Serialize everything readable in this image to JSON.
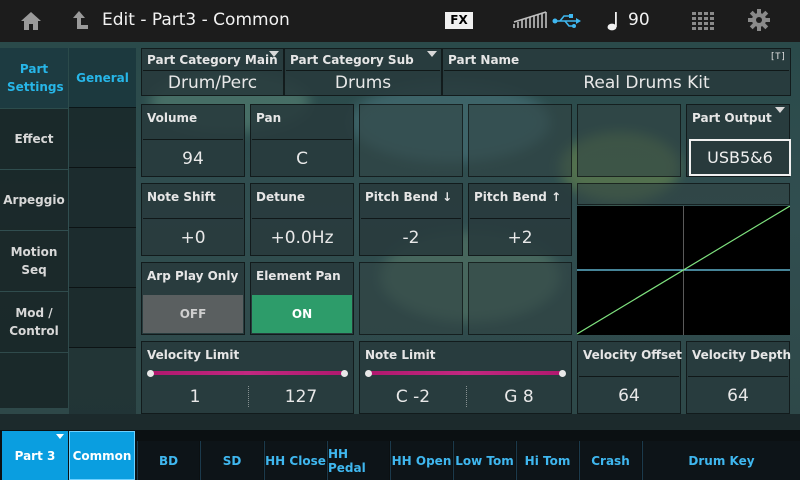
{
  "header": {
    "title": "Edit - Part3 - Common",
    "fx_label": "FX",
    "tempo": "90",
    "icons": [
      "home-icon",
      "up-arrow-icon",
      "meter-icon",
      "usb-icon",
      "quarter-note-icon",
      "keypad-grid-icon",
      "gear-icon"
    ]
  },
  "nav_primary": [
    {
      "label": "Part Settings",
      "active": true
    },
    {
      "label": "Effect",
      "active": false
    },
    {
      "label": "Arpeggio",
      "active": false
    },
    {
      "label": "Motion Seq",
      "active": false
    },
    {
      "label": "Mod / Control",
      "active": false
    }
  ],
  "nav_secondary": [
    {
      "label": "General",
      "active": true
    }
  ],
  "params": {
    "category_main": {
      "label": "Part Category Main",
      "value": "Drum/Perc"
    },
    "category_sub": {
      "label": "Part Category Sub",
      "value": "Drums"
    },
    "part_name": {
      "label": "Part Name",
      "value": "Real Drums Kit",
      "badge": "[T]"
    },
    "volume": {
      "label": "Volume",
      "value": "94"
    },
    "pan": {
      "label": "Pan",
      "value": "C"
    },
    "part_output": {
      "label": "Part Output",
      "value": "USB5&6"
    },
    "note_shift": {
      "label": "Note Shift",
      "value": "+0"
    },
    "detune": {
      "label": "Detune",
      "value": "+0.0Hz"
    },
    "pitch_bend_down": {
      "label": "Pitch Bend ↓",
      "value": "-2"
    },
    "pitch_bend_up": {
      "label": "Pitch Bend ↑",
      "value": "+2"
    },
    "arp_play_only": {
      "label": "Arp Play Only",
      "value": "OFF"
    },
    "element_pan": {
      "label": "Element Pan",
      "value": "ON"
    },
    "velocity_limit": {
      "label": "Velocity Limit",
      "low": "1",
      "high": "127"
    },
    "note_limit": {
      "label": "Note Limit",
      "low": "C -2",
      "high": "G 8"
    },
    "velocity_offset": {
      "label": "Velocity Offset",
      "value": "64"
    },
    "velocity_depth": {
      "label": "Velocity Depth",
      "value": "64"
    }
  },
  "velocity_curve": {
    "offset": 64,
    "depth": 64
  },
  "bottom": {
    "part": "Part 3",
    "common": "Common",
    "elements": [
      "BD",
      "SD",
      "HH Close",
      "HH Pedal",
      "HH Open",
      "Low Tom",
      "Hi Tom",
      "Crash",
      "Drum Key"
    ]
  },
  "colors": {
    "accent_blue": "#0a9ee0",
    "on_green": "#2d9c6a",
    "range_magenta": "#c22880",
    "curve_green": "#7ee07e",
    "center_cyan": "#6fd3f2"
  }
}
